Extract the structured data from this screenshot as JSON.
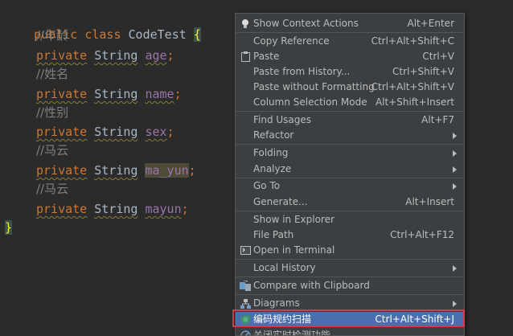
{
  "code": {
    "line1": {
      "kw": "public",
      "kw2": "class",
      "name": "CodeTest",
      "brace": "{"
    },
    "comment_age": "//年龄",
    "comment_name": "//姓名",
    "comment_sex": "//性别",
    "comment_mayun1": "//马云",
    "comment_mayun2": "//马云",
    "private_kw": "private",
    "string_type": "String",
    "fields": {
      "age": "age",
      "name": "name",
      "sex": "sex",
      "ma_yun": "ma_yun",
      "mayun": "mayun"
    },
    "semicolon": ";",
    "closing_brace": "}"
  },
  "context_menu": {
    "items": [
      {
        "label": "Show Context Actions",
        "shortcut": "Alt+Enter",
        "icon": "lightbulb-icon"
      },
      {
        "label": "Copy Reference",
        "shortcut": "Ctrl+Alt+Shift+C"
      },
      {
        "label": "Paste",
        "shortcut": "Ctrl+V",
        "icon": "clipboard-icon"
      },
      {
        "label": "Paste from History...",
        "shortcut": "Ctrl+Shift+V"
      },
      {
        "label": "Paste without Formatting",
        "shortcut": "Ctrl+Alt+Shift+V"
      },
      {
        "label": "Column Selection Mode",
        "shortcut": "Alt+Shift+Insert"
      },
      {
        "label": "Find Usages",
        "shortcut": "Alt+F7"
      },
      {
        "label": "Refactor",
        "submenu": true
      },
      {
        "label": "Folding",
        "submenu": true
      },
      {
        "label": "Analyze",
        "submenu": true
      },
      {
        "label": "Go To",
        "submenu": true
      },
      {
        "label": "Generate...",
        "shortcut": "Alt+Insert"
      },
      {
        "label": "Show in Explorer"
      },
      {
        "label": "File Path",
        "shortcut": "Ctrl+Alt+F12"
      },
      {
        "label": "Open in Terminal",
        "icon": "terminal-icon"
      },
      {
        "label": "Local History",
        "submenu": true
      },
      {
        "label": "Compare with Clipboard",
        "icon": "compare-icon"
      },
      {
        "label": "Diagrams",
        "submenu": true,
        "icon": "diagram-icon"
      },
      {
        "label": "编码规约扫描",
        "shortcut": "Ctrl+Alt+Shift+J",
        "icon": "scan-icon",
        "selected": true
      },
      {
        "label": "关闭实时检测功能",
        "icon": "stop-icon"
      }
    ]
  },
  "colors": {
    "editor_bg": "#2b2b2b",
    "menu_bg": "#3c3f41",
    "selection": "#4b6eaf",
    "highlight_outline": "#d23a52",
    "keyword": "#cc7832",
    "field": "#9876aa"
  }
}
